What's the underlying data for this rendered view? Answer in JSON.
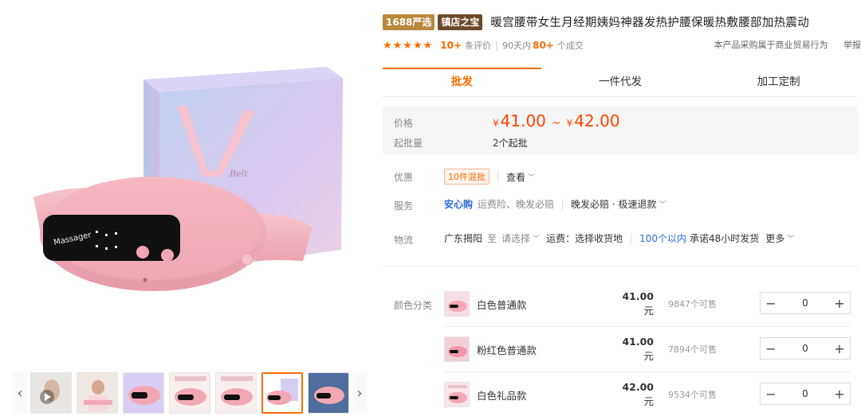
{
  "gallery": {
    "device_screen_text": "Massager",
    "box_text": "Belt",
    "prev_arrow": "‹",
    "next_arrow": "›",
    "thumb_count": 7,
    "active_thumb": 6
  },
  "header": {
    "badge_1688": "1688严选",
    "badge_zd": "镇店之宝",
    "title": "暖宫腰带女生月经期姨妈神器发热护腰保暖热敷腰部加热震动"
  },
  "meta": {
    "rating_stars": 5,
    "reviews_num": "10+",
    "reviews_label": "条评价",
    "sales_prefix": "90天内",
    "sales_num": "80+",
    "sales_label": "个成交",
    "notice": "本产品采购属于商业贸易行为",
    "report": "举报"
  },
  "tabs": [
    {
      "label": "批发",
      "active": true
    },
    {
      "label": "一件代发",
      "active": false
    },
    {
      "label": "加工定制",
      "active": false
    }
  ],
  "price": {
    "label": "价格",
    "currency": "¥",
    "low": "41.00",
    "separator": "~",
    "high": "42.00",
    "moq_label": "起批量",
    "moq_value": "2个起批"
  },
  "promo": {
    "label": "优惠",
    "tag": "10件混批",
    "view": "查看"
  },
  "service": {
    "label": "服务",
    "highlight": "安心购",
    "items": "运费险、晚发必赔",
    "extra": "晚发必赔 · 极速退款"
  },
  "logistics": {
    "label": "物流",
    "origin": "广东揭阳",
    "to": "至",
    "select": "请选择",
    "freight": "运费：选择收货地",
    "distance": "100个以内",
    "promise": "承诺48小时发货",
    "more": "更多"
  },
  "sku": {
    "label": "颜色分类",
    "unit": "元",
    "stock_suffix": "个可售",
    "items": [
      {
        "name": "白色普通款",
        "price": "41.00",
        "stock": "9847",
        "qty": "0"
      },
      {
        "name": "粉红色普通款",
        "price": "41.00",
        "stock": "7894",
        "qty": "0"
      },
      {
        "name": "白色礼品款",
        "price": "42.00",
        "stock": "9534",
        "qty": "0"
      }
    ],
    "minus": "−",
    "plus": "+"
  },
  "colors": {
    "accent": "#ff6a00",
    "price": "#ff4400",
    "link": "#2b6bd9",
    "product_pink": "#f2a8b4",
    "box_lilac": "#cfc6ee"
  }
}
